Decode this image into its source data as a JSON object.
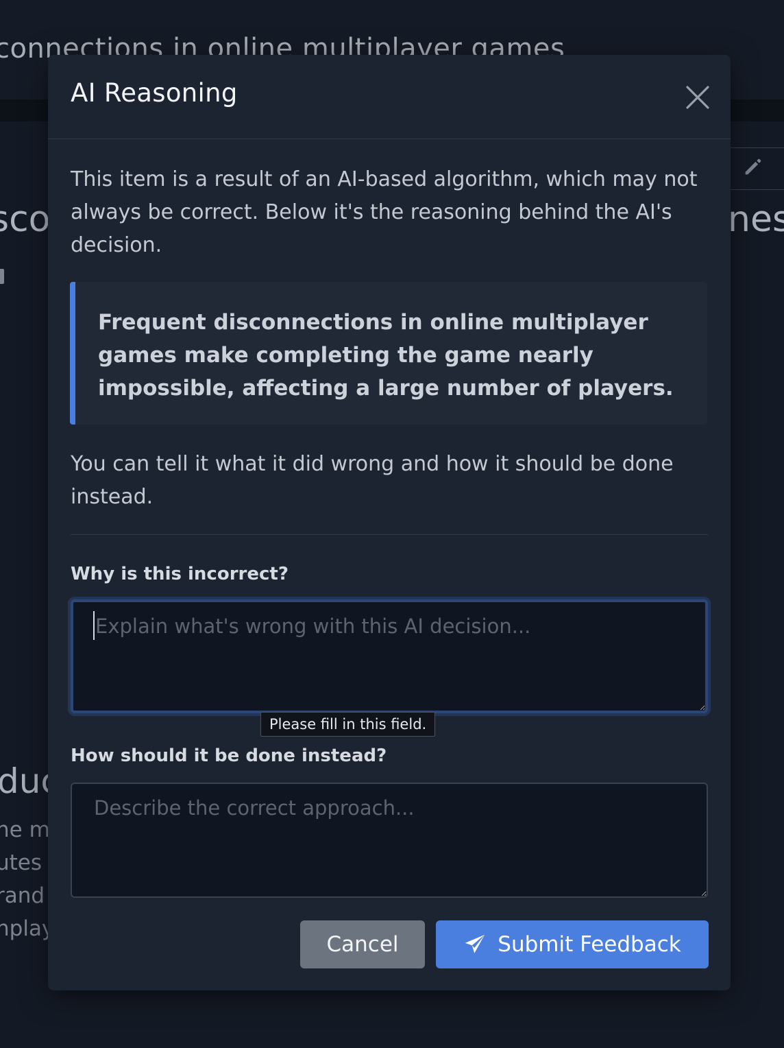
{
  "background": {
    "heading_fragment": "connections in online multiplayer games",
    "big_left_fragment": "sco",
    "big_right_fragment": "nes",
    "section_fragment": "duc",
    "para_fragments": [
      "ne mu",
      "utes",
      "rand",
      "nplaya"
    ]
  },
  "modal": {
    "title": "AI Reasoning",
    "intro": "This item is a result of an AI-based algorithm, which may not always be correct. Below it's the reasoning behind the AI's decision.",
    "reasoning_quote": "Frequent disconnections in online multiplayer games make completing the game nearly impossible, affecting a large number of players.",
    "feedback_prompt": "You can tell it what it did wrong and how it should be done instead.",
    "why_label": "Why is this incorrect?",
    "why_placeholder": "Explain what's wrong with this AI decision...",
    "why_value": "",
    "validation_tooltip": "Please fill in this field.",
    "how_label": "How should it be done instead?",
    "how_placeholder": "Describe the correct approach...",
    "how_value": "",
    "cancel_label": "Cancel",
    "submit_label": "Submit Feedback"
  },
  "colors": {
    "accent": "#4a7fe0",
    "modal_bg": "#1c2331",
    "cancel_bg": "#6c757f"
  },
  "icons": {
    "close": "close-icon",
    "submit": "paper-plane-icon",
    "edit": "pencil-icon"
  }
}
